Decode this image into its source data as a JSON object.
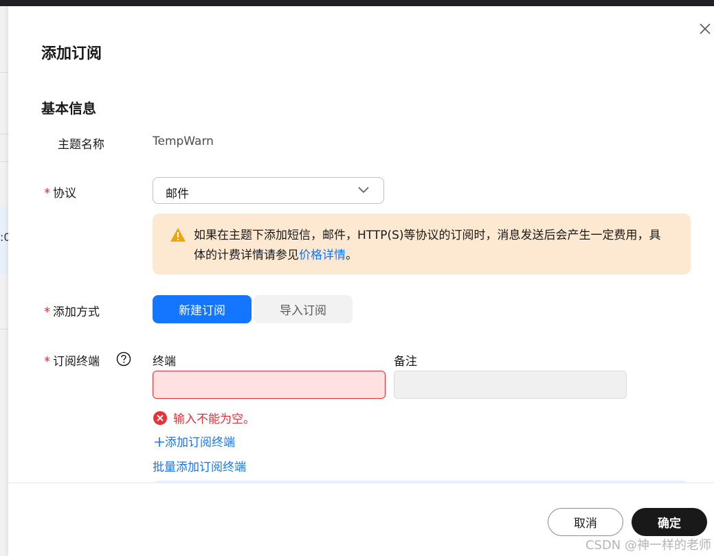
{
  "backdrop": {
    "fragment": ":0"
  },
  "drawer": {
    "title": "添加订阅",
    "section_title": "基本信息",
    "topic": {
      "label": "主题名称",
      "value": "TempWarn"
    },
    "protocol": {
      "required_mark": "*",
      "label": "协议",
      "selected": "邮件"
    },
    "notice": {
      "text": "如果在主题下添加短信，邮件，HTTP(S)等协议的订阅时，消息发送后会产生一定费用，具体的计费详情请参见",
      "link": "价格详情",
      "suffix": "。"
    },
    "add_method": {
      "required_mark": "*",
      "label": "添加方式",
      "options": [
        "新建订阅",
        "导入订阅"
      ],
      "selected_index": 0
    },
    "endpoint": {
      "required_mark": "*",
      "label": "订阅终端",
      "col_endpoint": "终端",
      "col_remark": "备注",
      "endpoint_value": "",
      "remark_value": "",
      "error": "输入不能为空。",
      "add_link": "添加订阅终端",
      "batch_link": "批量添加订阅终端"
    },
    "footer": {
      "cancel": "取消",
      "ok": "确定"
    }
  },
  "watermark": "CSDN @神一样的老师",
  "colors": {
    "primary": "#1476ff",
    "error": "#e5333a",
    "warning_bg": "#fde9d1",
    "warning_icon": "#f2a20c",
    "dark_button": "#191919"
  }
}
